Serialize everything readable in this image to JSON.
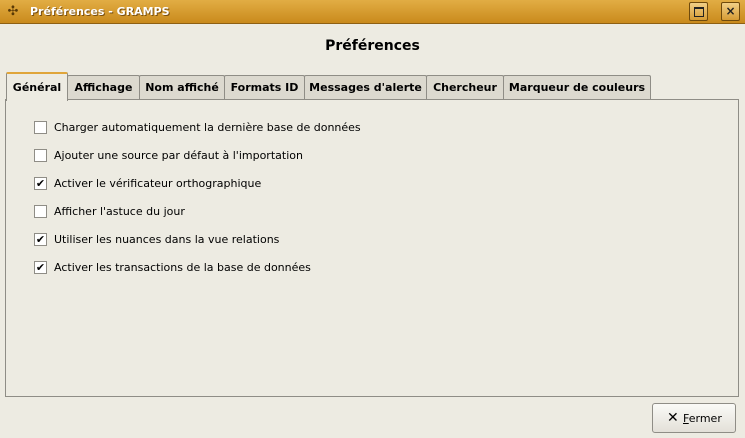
{
  "window": {
    "title": "Préférences - GRAMPS",
    "icon": "gramps-tree-icon",
    "maximize_glyph": "maximize-icon",
    "close_glyph": "×"
  },
  "dialog": {
    "title": "Préférences"
  },
  "tabs": [
    {
      "label": "Général",
      "active": true
    },
    {
      "label": "Affichage",
      "active": false
    },
    {
      "label": "Nom affiché",
      "active": false
    },
    {
      "label": "Formats ID",
      "active": false
    },
    {
      "label": "Messages d'alerte",
      "active": false
    },
    {
      "label": "Chercheur",
      "active": false
    },
    {
      "label": "Marqueur de couleurs",
      "active": false
    }
  ],
  "options": [
    {
      "label": "Charger automatiquement la dernière base de données",
      "checked": false
    },
    {
      "label": "Ajouter une source par défaut à l'importation",
      "checked": false
    },
    {
      "label": "Activer le vérificateur orthographique",
      "checked": true
    },
    {
      "label": "Afficher l'astuce du jour",
      "checked": false
    },
    {
      "label": "Utiliser les nuances dans la vue relations",
      "checked": true
    },
    {
      "label": "Activer les transactions de la base de données",
      "checked": true
    }
  ],
  "footer": {
    "close_label_mnemonic": "F",
    "close_label_rest": "ermer",
    "close_icon": "close-x-icon"
  },
  "colors": {
    "titlebar": "#d69b34",
    "background": "#edebe2",
    "active_tab_accent": "#e0a53a"
  }
}
